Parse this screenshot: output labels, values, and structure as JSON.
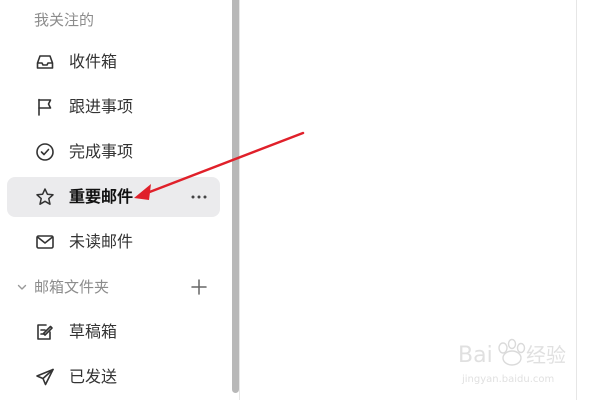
{
  "sidebar": {
    "section_title": "我关注的",
    "items": [
      {
        "label": "收件箱",
        "icon": "inbox-icon"
      },
      {
        "label": "跟进事项",
        "icon": "flag-icon"
      },
      {
        "label": "完成事项",
        "icon": "check-circle-icon"
      },
      {
        "label": "重要邮件",
        "icon": "star-icon",
        "selected": true
      },
      {
        "label": "未读邮件",
        "icon": "envelope-icon"
      }
    ],
    "folders_title": "邮箱文件夹",
    "folders": [
      {
        "label": "草稿箱",
        "icon": "draft-edit-icon"
      },
      {
        "label": "已发送",
        "icon": "send-icon"
      }
    ]
  },
  "colors": {
    "annotation_arrow": "#e0202a",
    "selected_background": "#ebebed",
    "muted_text": "#8c8c8c"
  },
  "watermark": "Baidu 经验 jingyan.baidu.com"
}
